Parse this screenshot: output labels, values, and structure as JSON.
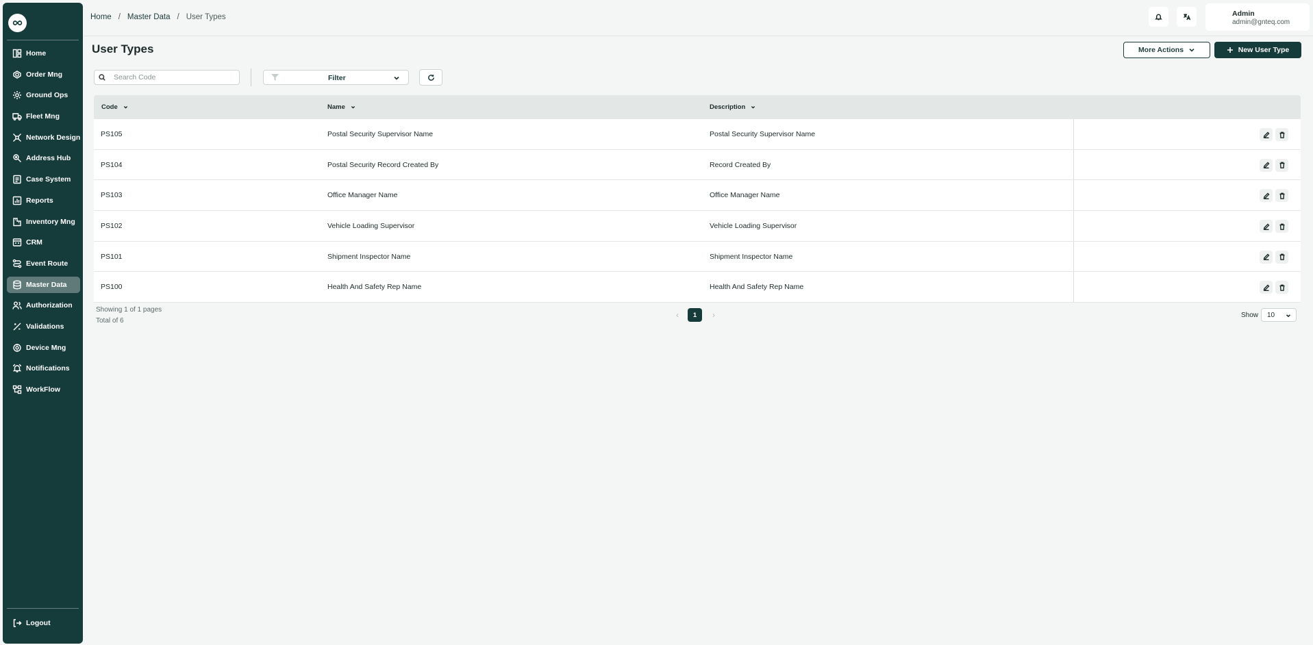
{
  "sidebar": {
    "items": [
      {
        "label": "Home",
        "icon": "home-icon"
      },
      {
        "label": "Order Mng",
        "icon": "order-icon"
      },
      {
        "label": "Ground Ops",
        "icon": "ground-ops-icon"
      },
      {
        "label": "Fleet Mng",
        "icon": "truck-icon"
      },
      {
        "label": "Network Design",
        "icon": "network-icon"
      },
      {
        "label": "Address Hub",
        "icon": "address-icon"
      },
      {
        "label": "Case System",
        "icon": "case-icon"
      },
      {
        "label": "Reports",
        "icon": "reports-icon"
      },
      {
        "label": "Inventory Mng",
        "icon": "inventory-icon"
      },
      {
        "label": "CRM",
        "icon": "crm-icon"
      },
      {
        "label": "Event Route",
        "icon": "route-icon"
      },
      {
        "label": "Master Data",
        "icon": "database-icon",
        "active": true
      },
      {
        "label": "Authorization",
        "icon": "users-icon"
      },
      {
        "label": "Validations",
        "icon": "validation-icon"
      },
      {
        "label": "Device Mng",
        "icon": "device-icon"
      },
      {
        "label": "Notifications",
        "icon": "bell-icon"
      },
      {
        "label": "WorkFlow",
        "icon": "workflow-icon"
      }
    ],
    "logout_label": "Logout"
  },
  "header": {
    "breadcrumb": [
      "Home",
      "Master Data",
      "User Types"
    ],
    "breadcrumb_separator": "/",
    "user": {
      "name": "Admin",
      "email": "admin@gnteq.com"
    }
  },
  "page": {
    "title": "User Types",
    "more_actions_label": "More Actions",
    "new_button_label": "New User Type"
  },
  "toolbar": {
    "search_placeholder": "Search Code",
    "filter_label": "Filter"
  },
  "table": {
    "columns": [
      "Code",
      "Name",
      "Description"
    ],
    "rows": [
      {
        "code": "PS105",
        "name": "Postal Security Supervisor Name",
        "description": "Postal Security Supervisor Name"
      },
      {
        "code": "PS104",
        "name": "Postal Security Record Created By",
        "description": "Record Created By"
      },
      {
        "code": "PS103",
        "name": "Office Manager Name",
        "description": "Office Manager Name"
      },
      {
        "code": "PS102",
        "name": "Vehicle Loading Supervisor",
        "description": "Vehicle Loading Supervisor"
      },
      {
        "code": "PS101",
        "name": "Shipment Inspector Name",
        "description": "Shipment Inspector Name"
      },
      {
        "code": "PS100",
        "name": "Health And Safety Rep Name",
        "description": "Health And Safety Rep Name"
      }
    ]
  },
  "pagination": {
    "showing_text": "Showing 1 of 1 pages",
    "total_text": "Total of 6",
    "current_page": "1",
    "prev_glyph": "‹",
    "next_glyph": "›",
    "show_label": "Show",
    "page_size": "10"
  },
  "colors": {
    "sidebar": "#163b3b",
    "active_item": "#5f7a79",
    "primary": "#163b3b",
    "background": "#f4f6f5"
  }
}
